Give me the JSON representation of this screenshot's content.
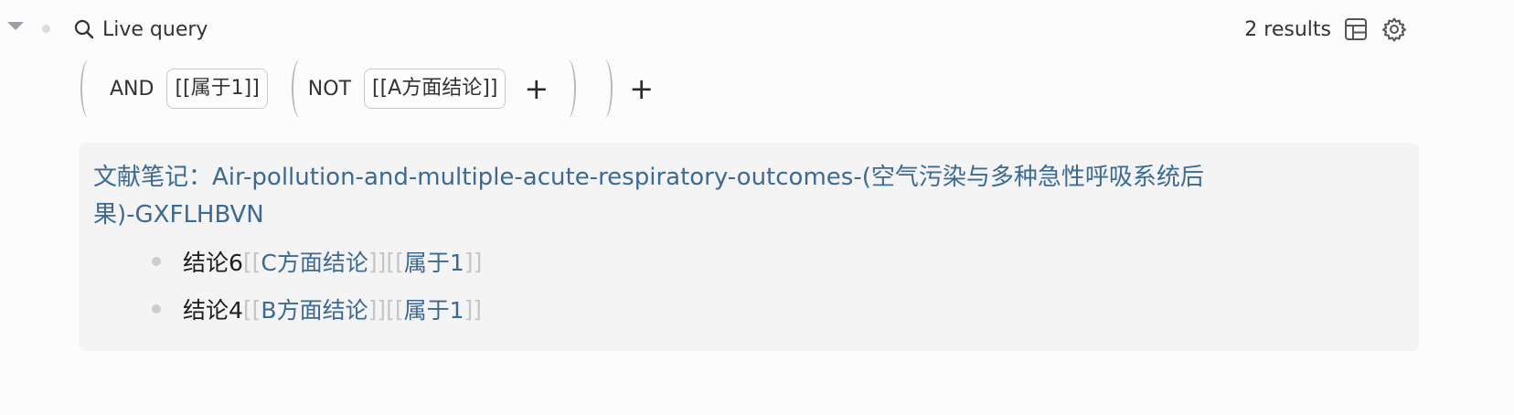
{
  "header": {
    "title": "Live query",
    "results_count": "2 results",
    "search_icon": "search-icon",
    "table_icon": "table-view-icon",
    "settings_icon": "gear-icon"
  },
  "builder": {
    "and_label": "AND",
    "and_ref": "[[属于1]]",
    "not_label": "NOT",
    "not_ref": "[[A方面结论]]",
    "add": "+"
  },
  "result": {
    "page_line1": "文献笔记：Air-pollution-and-multiple-acute-respiratory-outcomes-(空气污染与多种急性呼吸系统后",
    "page_line2": "果)-GXFLHBVN",
    "items": [
      {
        "text": "结论6",
        "open": "[[",
        "ref1": "C方面结论",
        "close": "]]",
        "ref2": "属于1"
      },
      {
        "text": "结论4",
        "open": "[[",
        "ref1": "B方面结论",
        "close": "]]",
        "ref2": "属于1"
      }
    ]
  },
  "colors": {
    "link": "#3c6a94",
    "bracket": "#c5c5c5",
    "panel": "#f4f4f5",
    "background": "#fcfcfc"
  }
}
